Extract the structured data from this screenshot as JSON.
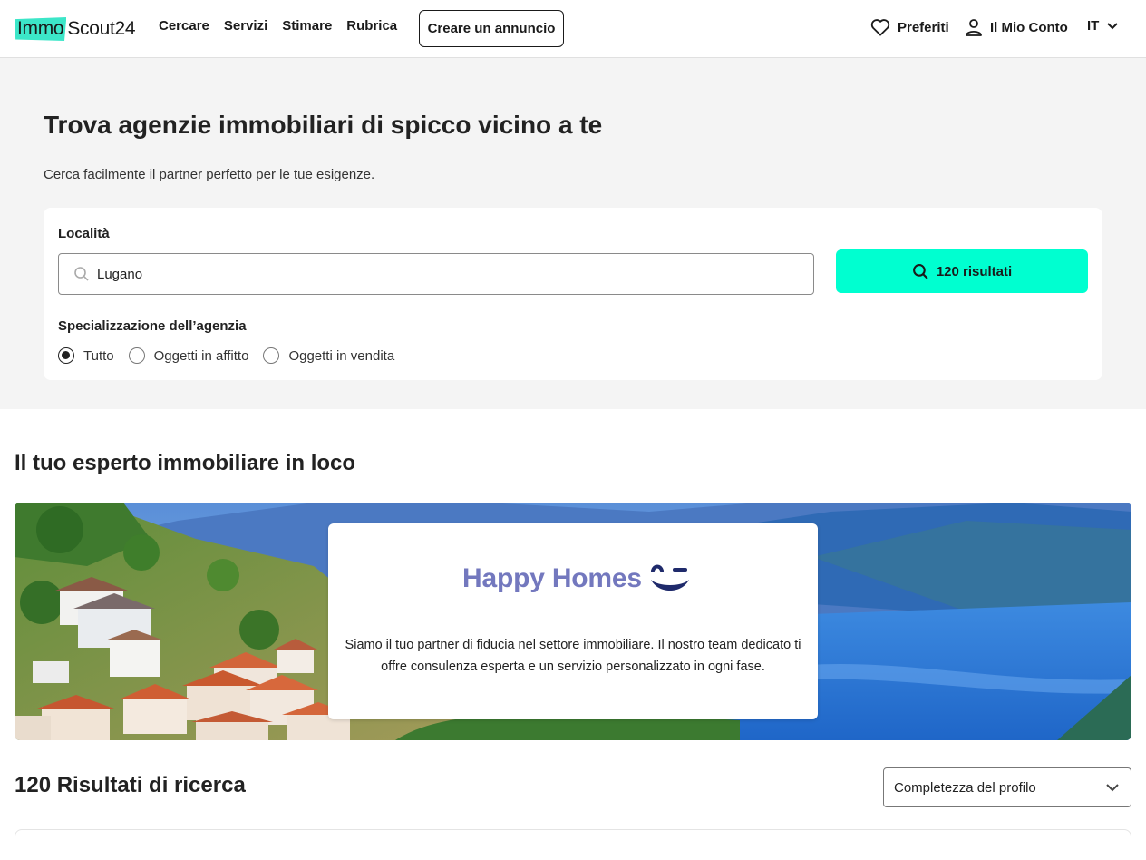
{
  "header": {
    "logo_immo": "Immo",
    "logo_scout": "Scout24",
    "nav": [
      "Cercare",
      "Servizi",
      "Stimare",
      "Rubrica"
    ],
    "create_button": "Creare un annuncio",
    "favorites": "Preferiti",
    "account": "Il Mio Conto",
    "language": "IT",
    "icons": {
      "favorites": "heart-icon",
      "account": "user-icon",
      "language": "chevron-down-icon"
    }
  },
  "hero": {
    "title": "Trova agenzie immobiliari di spicco vicino a te",
    "subtitle": "Cerca facilmente il partner perfetto per le tue esigenze.",
    "location_label": "Località",
    "location_value": "Lugano",
    "results_button": "120 risultati",
    "specialization_label": "Specializzazione dell’agenzia",
    "options": [
      {
        "label": "Tutto",
        "selected": true
      },
      {
        "label": "Oggetti in affitto",
        "selected": false
      },
      {
        "label": "Oggetti in vendita",
        "selected": false
      }
    ]
  },
  "expert": {
    "title": "Il tuo esperto immobiliare in loco",
    "agency_name": "Happy Homes",
    "description": "Siamo il tuo partner di fiducia nel settore immobiliare. Il nostro team dedicato ti offre consulenza esperta e un servizio personalizzato in ogni fase."
  },
  "results": {
    "title": "120 Risultati di ricerca",
    "sort_value": "Completezza del profilo"
  },
  "colors": {
    "accent": "#00ffd0",
    "logo_accent": "#3ce6c8",
    "hero_bg": "#f4f4f4",
    "agency_brand": "#7378be",
    "agency_dark": "#1f2a6b"
  }
}
